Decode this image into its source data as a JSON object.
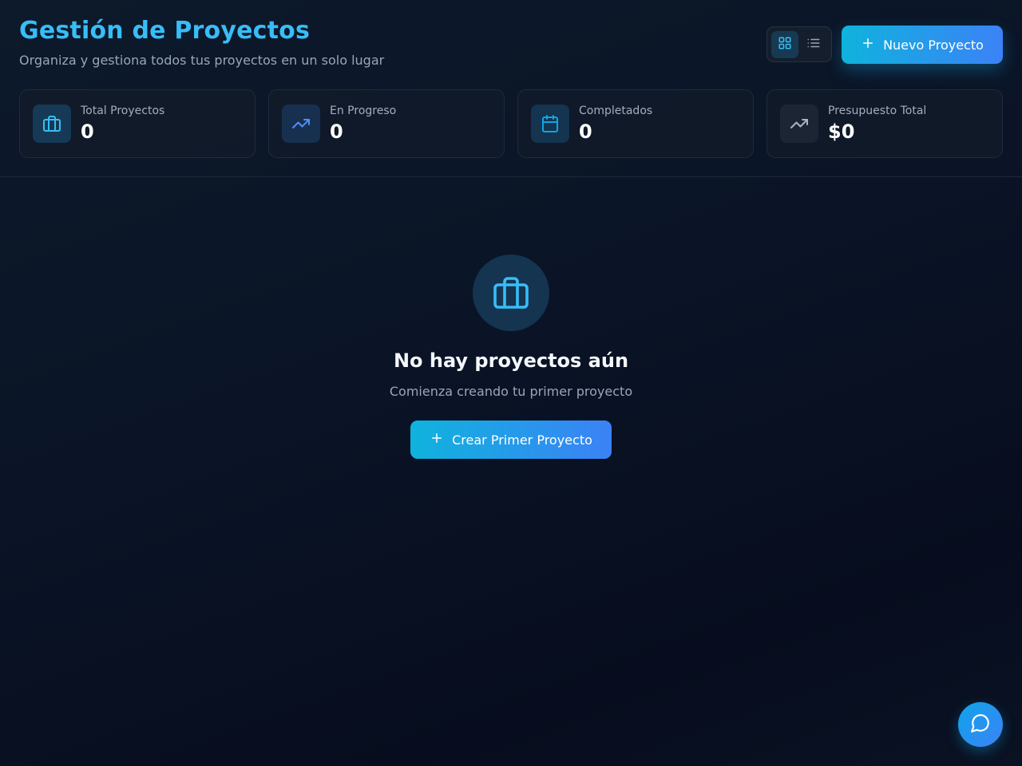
{
  "header": {
    "title": "Gestión de Proyectos",
    "subtitle": "Organiza y gestiona todos tus proyectos en un solo lugar",
    "view_toggle": {
      "grid_icon": "grid-icon",
      "list_icon": "list-icon",
      "active": "grid"
    },
    "new_button": {
      "label": "Nuevo Proyecto",
      "icon": "plus-icon"
    }
  },
  "stats": [
    {
      "label": "Total Proyectos",
      "value": "0",
      "icon": "briefcase-icon",
      "color": "#38bdf8"
    },
    {
      "label": "En Progreso",
      "value": "0",
      "icon": "trending-up-icon",
      "color": "#3b82f6"
    },
    {
      "label": "Completados",
      "value": "0",
      "icon": "calendar-icon",
      "color": "#0ea5e9"
    },
    {
      "label": "Presupuesto Total",
      "value": "$0",
      "icon": "trending-up-icon",
      "color": "#9ca3af"
    }
  ],
  "empty_state": {
    "icon": "briefcase-icon",
    "title": "No hay proyectos aún",
    "subtitle": "Comienza creando tu primer proyecto",
    "button": {
      "label": "Crear Primer Proyecto",
      "icon": "plus-icon"
    }
  },
  "chat_button": {
    "icon": "message-circle-icon"
  },
  "colors": {
    "accent": "#38bdf8",
    "gradient_start": "#0fb3dd",
    "gradient_end": "#3b82f6",
    "background": "#0a1426"
  }
}
